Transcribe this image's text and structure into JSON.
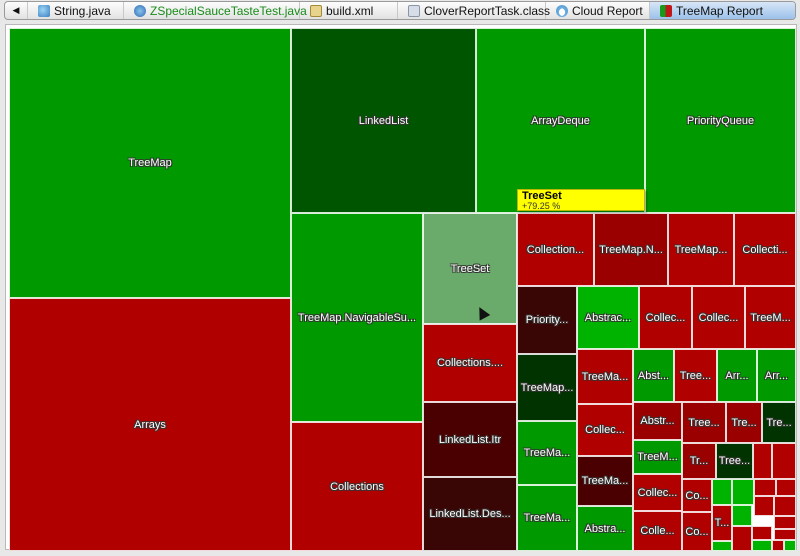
{
  "tabs": {
    "nav_back": "◀",
    "items": [
      {
        "label": "String.java",
        "icon": "java-class-icon",
        "icon_class": "ic-java",
        "active": false,
        "green": false
      },
      {
        "label": "ZSpecialSauceTasteTest.java",
        "icon": "test-class-icon",
        "icon_class": "ic-test",
        "active": false,
        "green": true
      },
      {
        "label": "build.xml",
        "icon": "xml-file-icon",
        "icon_class": "ic-xml",
        "active": false,
        "green": false
      },
      {
        "label": "CloverReportTask.class",
        "icon": "class-file-icon",
        "icon_class": "ic-class",
        "active": false,
        "green": false
      },
      {
        "label": "Cloud Report",
        "icon": "cloud-report-icon",
        "icon_class": "ic-cloud",
        "active": false,
        "green": false
      },
      {
        "label": "TreeMap Report",
        "icon": "treemap-report-icon",
        "icon_class": "ic-tree",
        "active": true,
        "green": false
      }
    ]
  },
  "colors": {
    "green": "#009900",
    "dark_green": "#005500",
    "bright_green": "#00b300",
    "pale_green": "#6aaa6a",
    "red": "#b00000",
    "mid_red": "#9a0000",
    "dark_red": "#4a0000",
    "very_dark_red": "#3a0505",
    "very_dark_green": "#003300"
  },
  "tooltip": {
    "name": "TreeSet",
    "value": "+79.25 %"
  },
  "treemap": {
    "cells": [
      {
        "label": "TreeMap",
        "color": "green"
      },
      {
        "label": "Arrays",
        "color": "red"
      },
      {
        "label": "LinkedList",
        "color": "dark_green"
      },
      {
        "label": "ArrayDeque",
        "color": "green"
      },
      {
        "label": "PriorityQueue",
        "color": "green"
      },
      {
        "label": "TreeMap.NavigableSu...",
        "color": "green"
      },
      {
        "label": "Collections",
        "color": "red"
      },
      {
        "label": "TreeSet",
        "color": "pale_green"
      },
      {
        "label": "Collections....",
        "color": "red"
      },
      {
        "label": "LinkedList.Itr",
        "color": "dark_red"
      },
      {
        "label": "LinkedList.Des...",
        "color": "very_dark_red"
      },
      {
        "label": "Collection...",
        "color": "red"
      },
      {
        "label": "TreeMap.N...",
        "color": "mid_red"
      },
      {
        "label": "TreeMap...",
        "color": "red"
      },
      {
        "label": "Collecti...",
        "color": "red"
      },
      {
        "label": "Priority...",
        "color": "very_dark_red"
      },
      {
        "label": "Abstrac...",
        "color": "bright_green"
      },
      {
        "label": "Collec...",
        "color": "red"
      },
      {
        "label": "Collec...",
        "color": "red"
      },
      {
        "label": "TreeM...",
        "color": "red"
      },
      {
        "label": "TreeMap...",
        "color": "very_dark_green"
      },
      {
        "label": "TreeMa...",
        "color": "red"
      },
      {
        "label": "Abst...",
        "color": "green"
      },
      {
        "label": "Tree...",
        "color": "red"
      },
      {
        "label": "Arr...",
        "color": "green"
      },
      {
        "label": "Arr...",
        "color": "green"
      },
      {
        "label": "TreeMa...",
        "color": "green"
      },
      {
        "label": "Collec...",
        "color": "red"
      },
      {
        "label": "Abstr...",
        "color": "mid_red"
      },
      {
        "label": "Tree...",
        "color": "mid_red"
      },
      {
        "label": "Tre...",
        "color": "mid_red"
      },
      {
        "label": "Tre...",
        "color": "very_dark_green"
      },
      {
        "label": "TreeMa...",
        "color": "green"
      },
      {
        "label": "TreeMa...",
        "color": "dark_red"
      },
      {
        "label": "TreeM...",
        "color": "green"
      },
      {
        "label": "Tr...",
        "color": "mid_red"
      },
      {
        "label": "Tree...",
        "color": "very_dark_green"
      },
      {
        "label": "",
        "color": "red"
      },
      {
        "label": "",
        "color": "red"
      },
      {
        "label": "Abstra...",
        "color": "green"
      },
      {
        "label": "Collec...",
        "color": "red"
      },
      {
        "label": "Co...",
        "color": "red"
      },
      {
        "label": "",
        "color": "bright_green"
      },
      {
        "label": "",
        "color": "bright_green"
      },
      {
        "label": "",
        "color": "red"
      },
      {
        "label": "",
        "color": "red"
      },
      {
        "label": "Colle...",
        "color": "red"
      },
      {
        "label": "Co...",
        "color": "red"
      },
      {
        "label": "T...",
        "color": "red"
      },
      {
        "label": "",
        "color": "bright_green"
      },
      {
        "label": "",
        "color": "red"
      },
      {
        "label": "",
        "color": "red"
      },
      {
        "label": "",
        "color": "bright_green"
      },
      {
        "label": "",
        "color": "red"
      },
      {
        "label": "",
        "color": "red"
      },
      {
        "label": "",
        "color": "red"
      },
      {
        "label": "",
        "color": "bright_green"
      },
      {
        "label": "",
        "color": "red"
      },
      {
        "label": "",
        "color": "red"
      },
      {
        "label": "",
        "color": "bright_green"
      }
    ]
  }
}
